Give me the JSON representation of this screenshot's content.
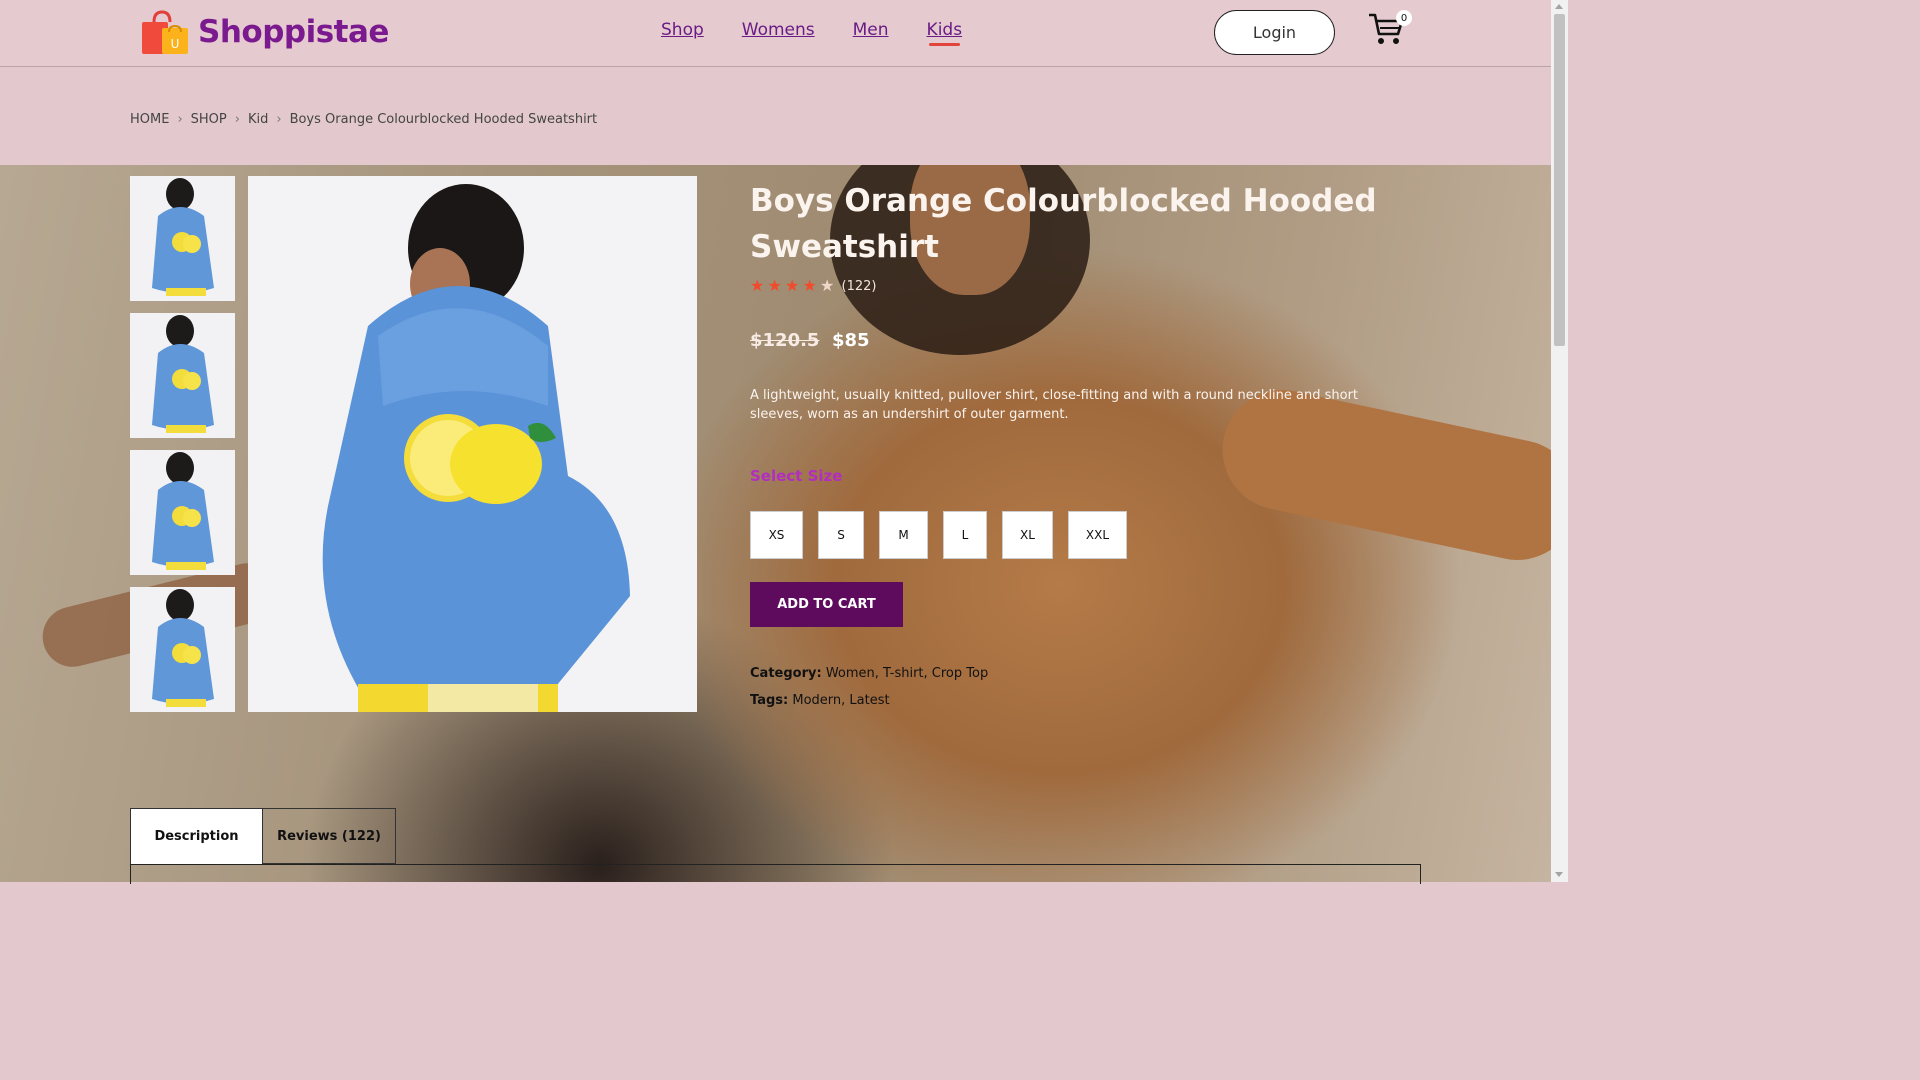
{
  "brand": {
    "name": "Shoppistae",
    "logo_icon": "shopping-bag-icon",
    "logo_letter": "U"
  },
  "nav": {
    "items": [
      {
        "label": "Shop",
        "active": false
      },
      {
        "label": "Womens",
        "active": false
      },
      {
        "label": "Men",
        "active": false
      },
      {
        "label": "Kids",
        "active": true
      }
    ]
  },
  "header": {
    "login_label": "Login",
    "cart_icon": "cart-icon",
    "cart_count": "0"
  },
  "breadcrumb": {
    "items": [
      "HOME",
      "SHOP",
      "Kid",
      "Boys Orange Colourblocked Hooded Sweatshirt"
    ],
    "separator_icon": "chevron-right-icon"
  },
  "product": {
    "title": "Boys Orange Colourblocked Hooded Sweatshirt",
    "rating": 4.5,
    "rating_count": "(122)",
    "old_price": "$120.5",
    "new_price": "$85",
    "description": "A lightweight, usually knitted, pullover shirt, close-fitting and with a round neckline and short sleeves, worn as an undershirt of outer garment.",
    "select_size_label": "Select Size",
    "sizes": [
      "XS",
      "S",
      "M",
      "L",
      "XL",
      "XXL"
    ],
    "add_to_cart_label": "ADD TO CART",
    "category_label": "Category:",
    "category_value": "Women, T-shirt, Crop Top",
    "tags_label": "Tags:",
    "tags_value": "Modern, Latest",
    "thumbnail_count": 4
  },
  "tabs": [
    {
      "label": "Description",
      "active": true
    },
    {
      "label": "Reviews (122)",
      "active": false
    }
  ],
  "colors": {
    "header_bg": "#e5cbcf",
    "brand": "#7b1a8f",
    "accent_button": "#5e0b5e",
    "star": "#f14b2c",
    "select_size": "#b22ec0"
  }
}
